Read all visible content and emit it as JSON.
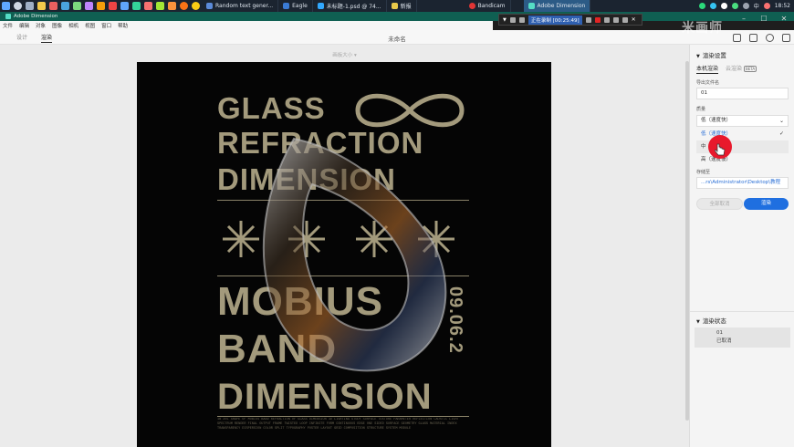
{
  "taskbar": {
    "tabs": [
      {
        "label": "Random text gener...",
        "color": "#5b8ad8"
      },
      {
        "label": "Eagle",
        "color": "#3a7bd5"
      },
      {
        "label": "未标题-1.psd @ 74...",
        "color": "#31a8ff"
      },
      {
        "label": "新报",
        "color": "#e8c94a"
      },
      {
        "label": "Bandicam",
        "color": "#e03535"
      },
      {
        "label": "Adobe Dimension",
        "color": "#55ddc5"
      }
    ],
    "tray": {
      "lang": "中",
      "time": "18:52"
    }
  },
  "window": {
    "title": "Adobe Dimension"
  },
  "recorder": {
    "status": "正在录制 [00:25:49]"
  },
  "menu": {
    "items": [
      "文件",
      "编辑",
      "对象",
      "图像",
      "相机",
      "视图",
      "窗口",
      "帮助"
    ]
  },
  "modes": {
    "design": "设计",
    "render": "渲染"
  },
  "doc": {
    "title": "未命名",
    "canvas_size": "画板大小 ▾"
  },
  "watermark": "米画师",
  "poster": {
    "lines": [
      "GLASS",
      "REFRACTION",
      "DIMENSION",
      "MOBIUS",
      "BAND",
      "DIMENSION"
    ],
    "date": "09.06.2",
    "small": "1B 20L SHAPE OF MOBIUS BAND REFRACTION OF GLASS DIMENSION 3D LIGHTING STUDY SURFACE TEXTURE PARAMETER REFLECTION CAUSTIC LIGHT SPECTRUM RENDER FINAL OUTPUT FRAME TWISTED LOOP INFINITE FORM CONTINUOUS EDGE ONE SIDED SURFACE GEOMETRY GLASS MATERIAL INDEX TRANSPARENCY DISPERSION COLOR SPLIT TYPOGRAPHY POSTER LAYOUT GRID COMPOSITION STRUCTURE SYSTEM MODULE"
  },
  "panel": {
    "render_settings": "渲染设置",
    "tab_local": "本机渲染",
    "tab_cloud": "云渲染",
    "beta": "BETA",
    "export_name_label": "导出文件名",
    "export_name": "01",
    "quality_label": "质量",
    "quality_selected": "低（速度快）",
    "options": [
      "低（速度快）",
      "中",
      "高（速度慢）"
    ],
    "save_label": "存储至",
    "save_path": "...rs\\Administrator\\Desktop\\教程",
    "cancel_all": "全部取消",
    "render": "渲染",
    "render_status": "渲染状态",
    "status_name": "01",
    "status_text": "已取消"
  },
  "colors": {
    "accent": "#1f6fe0",
    "poster_text": "#a39a7c",
    "cursor": "#e8192c"
  }
}
